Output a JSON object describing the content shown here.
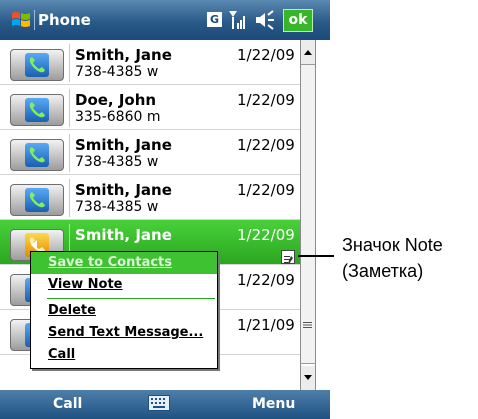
{
  "title_bar": {
    "title": "Phone",
    "gprs_label": "G",
    "ok_label": "ok"
  },
  "call_log": [
    {
      "name": "Smith, Jane",
      "number": "738-4385 w",
      "date": "1/22/09",
      "call_type": "incoming"
    },
    {
      "name": "Doe, John",
      "number": "335-6860 m",
      "date": "1/22/09",
      "call_type": "incoming"
    },
    {
      "name": "Smith, Jane",
      "number": "738-4385 w",
      "date": "1/22/09",
      "call_type": "incoming"
    },
    {
      "name": "Smith, Jane",
      "number": "738-4385 w",
      "date": "1/22/09",
      "call_type": "incoming"
    },
    {
      "name": "Smith, Jane",
      "number": "",
      "date": "1/22/09",
      "call_type": "outgoing",
      "selected": true,
      "has_note": true
    },
    {
      "name": "",
      "number": "",
      "date": "1/22/09",
      "call_type": "incoming"
    },
    {
      "name": "",
      "number": "",
      "date": "1/21/09",
      "call_type": "incoming"
    }
  ],
  "context_menu": {
    "items": [
      {
        "label": "Save to Contacts",
        "highlighted": true
      },
      {
        "label": "View Note"
      },
      {
        "label": "Delete"
      },
      {
        "label": "Send Text Message..."
      },
      {
        "label": "Call"
      }
    ]
  },
  "softkeys": {
    "left": "Call",
    "right": "Menu"
  },
  "callout": {
    "line1": "Значок Note",
    "line2": "(Заметка)"
  },
  "colors": {
    "title_bar": "#2a5a88",
    "selection": "#3fc232",
    "ok_button": "#35b729"
  },
  "icons": {
    "start": "windows-flag-icon",
    "signal": "signal-strength-icon",
    "volume": "speaker-icon",
    "keyboard": "keyboard-icon",
    "note": "note-icon"
  }
}
